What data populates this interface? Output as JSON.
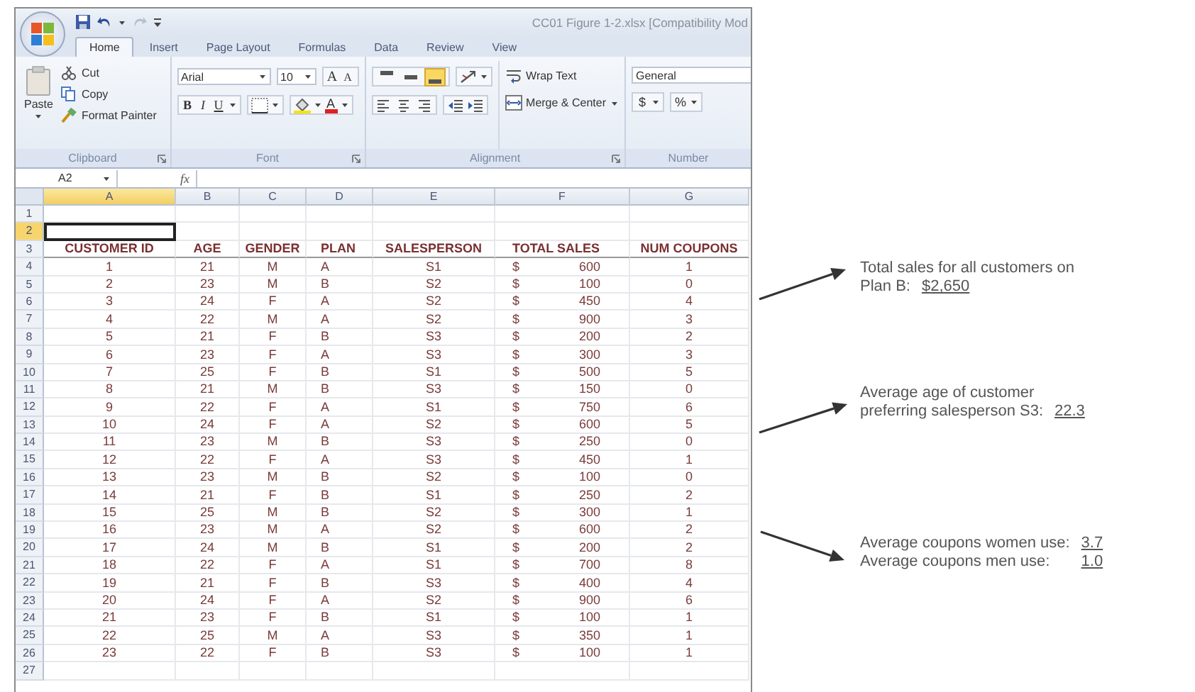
{
  "window": {
    "title": "CC01 Figure 1-2.xlsx  [Compatibility Mod"
  },
  "tabs": [
    {
      "label": "Home",
      "selected": true
    },
    {
      "label": "Insert",
      "selected": false
    },
    {
      "label": "Page Layout",
      "selected": false
    },
    {
      "label": "Formulas",
      "selected": false
    },
    {
      "label": "Data",
      "selected": false
    },
    {
      "label": "Review",
      "selected": false
    },
    {
      "label": "View",
      "selected": false
    }
  ],
  "clipboard": {
    "name": "Clipboard",
    "paste": "Paste",
    "items": [
      "Cut",
      "Copy",
      "Format Painter"
    ]
  },
  "font": {
    "name": "Font",
    "font_name": "Arial",
    "size": "10",
    "size_buttons": [
      "A",
      "A"
    ],
    "style_buttons": [
      "B",
      "I",
      "U"
    ],
    "color_letter": "A"
  },
  "alignment": {
    "name": "Alignment",
    "vertical_buttons": [
      {
        "selected": false
      },
      {
        "selected": false
      },
      {
        "selected": true
      }
    ],
    "wrap": "Wrap Text",
    "merge": "Merge & Center"
  },
  "number": {
    "name": "Number",
    "format": "General",
    "buttons": [
      "$",
      "%"
    ]
  },
  "formula_bar": {
    "name_box": "A2",
    "function_label": "fx"
  },
  "sheet": {
    "columns": [
      {
        "label": "A",
        "selected": true
      },
      {
        "label": "B",
        "selected": false
      },
      {
        "label": "C",
        "selected": false
      },
      {
        "label": "D",
        "selected": false
      },
      {
        "label": "E",
        "selected": false
      },
      {
        "label": "F",
        "selected": false
      },
      {
        "label": "G",
        "selected": false
      }
    ],
    "rows": [
      {
        "number": "1",
        "selected": false,
        "kind": "empty"
      },
      {
        "number": "2",
        "selected": true,
        "kind": "empty"
      },
      {
        "number": "3",
        "selected": false,
        "kind": "header",
        "cells": [
          "CUSTOMER ID",
          "AGE",
          "GENDER",
          "PLAN",
          "SALESPERSON",
          "TOTAL SALES",
          "NUM COUPONS"
        ]
      },
      {
        "number": "4",
        "selected": false,
        "kind": "data",
        "cells": [
          "1",
          "21",
          "M",
          "A",
          "S1",
          "$",
          "600",
          "1"
        ]
      },
      {
        "number": "5",
        "selected": false,
        "kind": "data",
        "cells": [
          "2",
          "23",
          "M",
          "B",
          "S2",
          "$",
          "100",
          "0"
        ]
      },
      {
        "number": "6",
        "selected": false,
        "kind": "data",
        "cells": [
          "3",
          "24",
          "F",
          "A",
          "S2",
          "$",
          "450",
          "4"
        ]
      },
      {
        "number": "7",
        "selected": false,
        "kind": "data",
        "cells": [
          "4",
          "22",
          "M",
          "A",
          "S2",
          "$",
          "900",
          "3"
        ]
      },
      {
        "number": "8",
        "selected": false,
        "kind": "data",
        "cells": [
          "5",
          "21",
          "F",
          "B",
          "S3",
          "$",
          "200",
          "2"
        ]
      },
      {
        "number": "9",
        "selected": false,
        "kind": "data",
        "cells": [
          "6",
          "23",
          "F",
          "A",
          "S3",
          "$",
          "300",
          "3"
        ]
      },
      {
        "number": "10",
        "selected": false,
        "kind": "data",
        "cells": [
          "7",
          "25",
          "F",
          "B",
          "S1",
          "$",
          "500",
          "5"
        ]
      },
      {
        "number": "11",
        "selected": false,
        "kind": "data",
        "cells": [
          "8",
          "21",
          "M",
          "B",
          "S3",
          "$",
          "150",
          "0"
        ]
      },
      {
        "number": "12",
        "selected": false,
        "kind": "data",
        "cells": [
          "9",
          "22",
          "F",
          "A",
          "S1",
          "$",
          "750",
          "6"
        ]
      },
      {
        "number": "13",
        "selected": false,
        "kind": "data",
        "cells": [
          "10",
          "24",
          "F",
          "A",
          "S2",
          "$",
          "600",
          "5"
        ]
      },
      {
        "number": "14",
        "selected": false,
        "kind": "data",
        "cells": [
          "11",
          "23",
          "M",
          "B",
          "S3",
          "$",
          "250",
          "0"
        ]
      },
      {
        "number": "15",
        "selected": false,
        "kind": "data",
        "cells": [
          "12",
          "22",
          "F",
          "A",
          "S3",
          "$",
          "450",
          "1"
        ]
      },
      {
        "number": "16",
        "selected": false,
        "kind": "data",
        "cells": [
          "13",
          "23",
          "M",
          "B",
          "S2",
          "$",
          "100",
          "0"
        ]
      },
      {
        "number": "17",
        "selected": false,
        "kind": "data",
        "cells": [
          "14",
          "21",
          "F",
          "B",
          "S1",
          "$",
          "250",
          "2"
        ]
      },
      {
        "number": "18",
        "selected": false,
        "kind": "data",
        "cells": [
          "15",
          "25",
          "M",
          "B",
          "S2",
          "$",
          "300",
          "1"
        ]
      },
      {
        "number": "19",
        "selected": false,
        "kind": "data",
        "cells": [
          "16",
          "23",
          "M",
          "A",
          "S2",
          "$",
          "600",
          "2"
        ]
      },
      {
        "number": "20",
        "selected": false,
        "kind": "data",
        "cells": [
          "17",
          "24",
          "M",
          "B",
          "S1",
          "$",
          "200",
          "2"
        ]
      },
      {
        "number": "21",
        "selected": false,
        "kind": "data",
        "cells": [
          "18",
          "22",
          "F",
          "A",
          "S1",
          "$",
          "700",
          "8"
        ]
      },
      {
        "number": "22",
        "selected": false,
        "kind": "data",
        "cells": [
          "19",
          "21",
          "F",
          "B",
          "S3",
          "$",
          "400",
          "4"
        ]
      },
      {
        "number": "23",
        "selected": false,
        "kind": "data",
        "cells": [
          "20",
          "24",
          "F",
          "A",
          "S2",
          "$",
          "900",
          "6"
        ]
      },
      {
        "number": "24",
        "selected": false,
        "kind": "data",
        "cells": [
          "21",
          "23",
          "F",
          "B",
          "S1",
          "$",
          "100",
          "1"
        ]
      },
      {
        "number": "25",
        "selected": false,
        "kind": "data",
        "cells": [
          "22",
          "25",
          "M",
          "A",
          "S3",
          "$",
          "350",
          "1"
        ]
      },
      {
        "number": "26",
        "selected": false,
        "kind": "data",
        "cells": [
          "23",
          "22",
          "F",
          "B",
          "S3",
          "$",
          "100",
          "1"
        ]
      },
      {
        "number": "27",
        "selected": false,
        "kind": "empty"
      }
    ]
  },
  "notes": [
    {
      "rows": [
        {
          "label": "Total sales for all customers on"
        },
        {
          "label": "Plan B:",
          "answer": "$2,650"
        }
      ]
    },
    {
      "rows": [
        {
          "label": "Average age of customer"
        },
        {
          "label": "preferring salesperson S3:",
          "answer": "22.3"
        }
      ]
    },
    {
      "rows": [
        {
          "label": "Average coupons women use:",
          "answer": "3.7"
        },
        {
          "label": "Average coupons men use:",
          "answer": "1.0"
        }
      ]
    }
  ]
}
